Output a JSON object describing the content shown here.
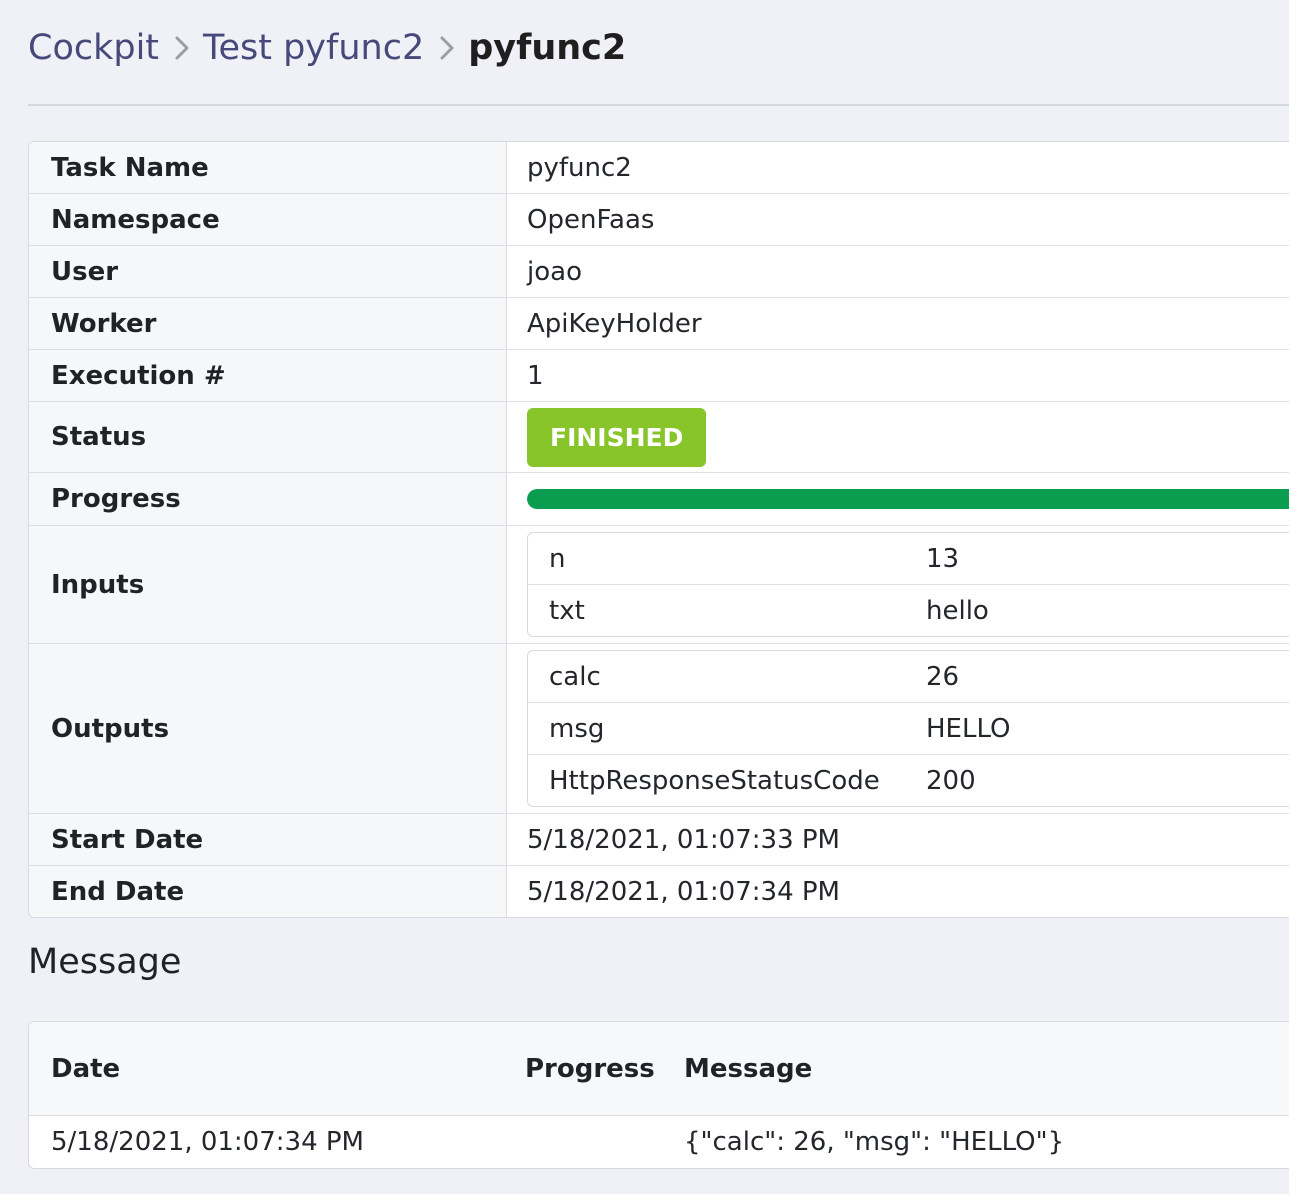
{
  "breadcrumb": {
    "items": [
      "Cockpit",
      "Test pyfunc2"
    ],
    "current": "pyfunc2"
  },
  "details": {
    "task_name_label": "Task Name",
    "task_name": "pyfunc2",
    "namespace_label": "Namespace",
    "namespace": "OpenFaas",
    "user_label": "User",
    "user": "joao",
    "worker_label": "Worker",
    "worker": "ApiKeyHolder",
    "execution_label": "Execution #",
    "execution": "1",
    "status_label": "Status",
    "status": "FINISHED",
    "progress_label": "Progress",
    "progress_percent": 100,
    "inputs_label": "Inputs",
    "inputs": [
      {
        "key": "n",
        "value": "13"
      },
      {
        "key": "txt",
        "value": "hello"
      }
    ],
    "outputs_label": "Outputs",
    "outputs": [
      {
        "key": "calc",
        "value": "26"
      },
      {
        "key": "msg",
        "value": "HELLO"
      },
      {
        "key": "HttpResponseStatusCode",
        "value": "200"
      }
    ],
    "start_date_label": "Start Date",
    "start_date": "5/18/2021, 01:07:33 PM",
    "end_date_label": "End Date",
    "end_date": "5/18/2021, 01:07:34 PM"
  },
  "message_section": {
    "title": "Message",
    "columns": {
      "date": "Date",
      "progress": "Progress",
      "message": "Message"
    },
    "rows": [
      {
        "date": "5/18/2021, 01:07:34 PM",
        "progress": "",
        "message": "{\"calc\": 26, \"msg\": \"HELLO\"}"
      }
    ]
  },
  "colors": {
    "status_finished": "#87c52a",
    "progress_fill": "#0a9c4f",
    "breadcrumb_link": "#47497a"
  }
}
